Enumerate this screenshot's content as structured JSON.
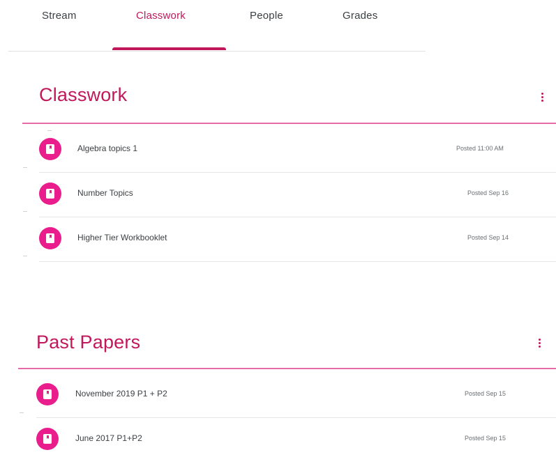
{
  "tabs": [
    {
      "label": "Stream",
      "active": false
    },
    {
      "label": "Classwork",
      "active": true
    },
    {
      "label": "People",
      "active": false
    },
    {
      "label": "Grades",
      "active": false
    }
  ],
  "colors": {
    "accent": "#c2185b",
    "icon_bg": "#e91e8c",
    "rule": "#e56ba8"
  },
  "sections": [
    {
      "title": "Classwork",
      "more_icon": "more-vert-icon",
      "items": [
        {
          "title": "Algebra topics 1",
          "date": "Posted 11:00 AM",
          "icon": "material-book-icon"
        },
        {
          "title": "Number Topics",
          "date": "Posted Sep 16",
          "icon": "material-book-icon"
        },
        {
          "title": "Higher Tier Workbooklet",
          "date": "Posted Sep 14",
          "icon": "material-book-icon"
        }
      ]
    },
    {
      "title": "Past Papers",
      "more_icon": "more-vert-icon",
      "items": [
        {
          "title": "November 2019 P1 + P2",
          "date": "Posted Sep 15",
          "icon": "material-book-icon"
        },
        {
          "title": "June 2017 P1+P2",
          "date": "Posted Sep 15",
          "icon": "material-book-icon"
        }
      ]
    }
  ]
}
